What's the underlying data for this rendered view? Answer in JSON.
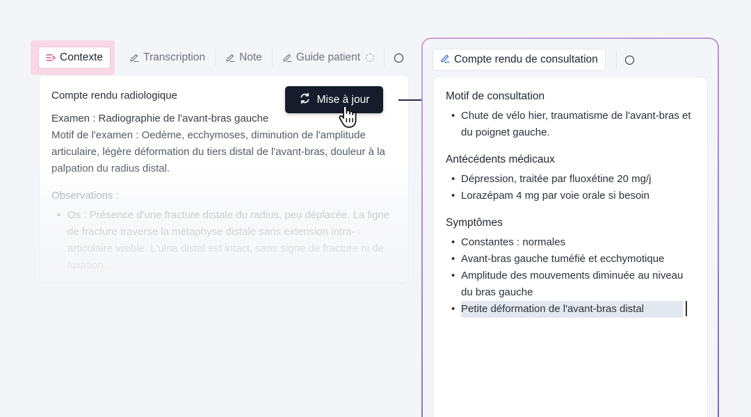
{
  "left": {
    "tabs": [
      {
        "label": "Contexte",
        "icon": "context-icon",
        "active": true
      },
      {
        "label": "Transcription",
        "icon": "pencil-icon"
      },
      {
        "label": "Note",
        "icon": "pencil-icon"
      },
      {
        "label": "Guide patient",
        "icon": "pencil-icon"
      }
    ],
    "card": {
      "title": "Compte rendu radiologique",
      "exam": "Examen : Radiographie de l'avant-bras gauche",
      "motif": "Motif de l'examen : Oedème, ecchymoses, diminution de l'amplitude articulaire, légère déformation du tiers distal de l'avant-bras, douleur à la palpation du radius distal.",
      "observations_label": "Observations :",
      "observations": [
        "Os : Présence d'une fracture distale du radius, peu déplacée. La ligne de fracture traverse la métaphyse distale sans extension intra-articulaire visible. L'ulna distal est intact, sans signe de fracture ni de luxation."
      ]
    },
    "update_button": "Mise à jour"
  },
  "right": {
    "tab_label": "Compte rendu de consultation",
    "sections": [
      {
        "title": "Motif de consultation",
        "items": [
          "Chute de vélo hier, traumatisme de l'avant-bras et du poignet gauche."
        ]
      },
      {
        "title": "Antécédents médicaux",
        "items": [
          "Dépression, traitée par fluoxétine 20 mg/j",
          "Lorazépam 4 mg par voie orale si besoin"
        ]
      },
      {
        "title": "Symptômes",
        "items": [
          "Constantes : normales",
          "Avant-bras gauche tuméfié et ecchymotique",
          "Amplitude des mouvements diminuée au niveau du bras gauche",
          "Petite déformation de l'avant-bras distal"
        ]
      }
    ]
  },
  "colors": {
    "accent_pink": "#e05592",
    "dark_button": "#161c2b",
    "gradient_start": "#c9a2d9",
    "gradient_end": "#6b6cc8"
  }
}
